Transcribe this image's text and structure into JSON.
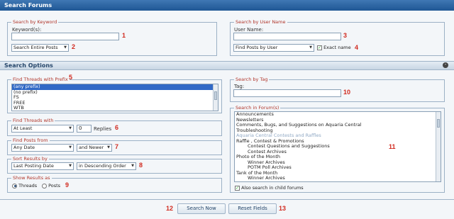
{
  "header": {
    "title": "Search Forums"
  },
  "keyword": {
    "legend": "Search by Keyword",
    "label": "Keyword(s):",
    "value": "",
    "scope": "Search Entire Posts",
    "callout_1": "1",
    "callout_2": "2"
  },
  "username": {
    "legend": "Search by User Name",
    "label": "User Name:",
    "value": "",
    "mode": "Find Posts by User",
    "exact_label": "Exact name",
    "exact_checked": true,
    "callout_3": "3",
    "callout_4": "4"
  },
  "options_bar": {
    "title": "Search Options"
  },
  "prefix": {
    "legend": "Find Threads with Prefix",
    "callout": "5",
    "options": [
      "(any prefix)",
      "(no prefix)",
      "FS",
      "FREE",
      "WTB"
    ],
    "selected_index": 0
  },
  "threads_with": {
    "legend": "Find Threads with",
    "mode": "At Least",
    "count": "0",
    "suffix": "Replies",
    "callout": "6"
  },
  "posts_from": {
    "legend": "Find Posts from",
    "date": "Any Date",
    "direction": "and Newer",
    "callout": "7"
  },
  "sort": {
    "legend": "Sort Results by",
    "field": "Last Posting Date",
    "order": "in Descending Order",
    "callout": "8"
  },
  "show_as": {
    "legend": "Show Results as",
    "threads_label": "Threads",
    "posts_label": "Posts",
    "selected": "threads",
    "callout": "9"
  },
  "tag": {
    "legend": "Search by Tag",
    "label": "Tag:",
    "value": "",
    "callout": "10"
  },
  "forums": {
    "legend": "Search in Forum(s)",
    "callout": "11",
    "items": [
      {
        "text": "Announcements",
        "level": 1,
        "category": false
      },
      {
        "text": "Newsletters",
        "level": 1,
        "category": false
      },
      {
        "text": "Comments, Bugs, and Suggestions on Aquaria Central",
        "level": 1,
        "category": false
      },
      {
        "text": "Troubleshooting",
        "level": 1,
        "category": false
      },
      {
        "text": "Aquaria Central Contests and Raffles",
        "level": 0,
        "category": true
      },
      {
        "text": "Raffle , Contest & Promotions",
        "level": 1,
        "category": false
      },
      {
        "text": "Contest Questions and Suggestions",
        "level": 2,
        "category": false
      },
      {
        "text": "Contest Archives",
        "level": 2,
        "category": false
      },
      {
        "text": "Photo of the Month",
        "level": 1,
        "category": false
      },
      {
        "text": "Winner Archives",
        "level": 2,
        "category": false
      },
      {
        "text": "POTM Poll Archives",
        "level": 2,
        "category": false
      },
      {
        "text": "Tank of the Month",
        "level": 1,
        "category": false
      },
      {
        "text": "Winner Archives",
        "level": 2,
        "category": false
      }
    ],
    "child_label": "Also search in child forums",
    "child_checked": true
  },
  "actions": {
    "search_label": "Search Now",
    "reset_label": "Reset Fields",
    "callout_12": "12",
    "callout_13": "13"
  },
  "icons": {
    "collapse": "collapse-icon",
    "dropdown": "chevron-down-icon"
  },
  "colors": {
    "header_blue": "#2a64a4",
    "legend_red": "#b0352a",
    "callout_red": "#d12a1f",
    "selection_blue": "#3169c6"
  }
}
